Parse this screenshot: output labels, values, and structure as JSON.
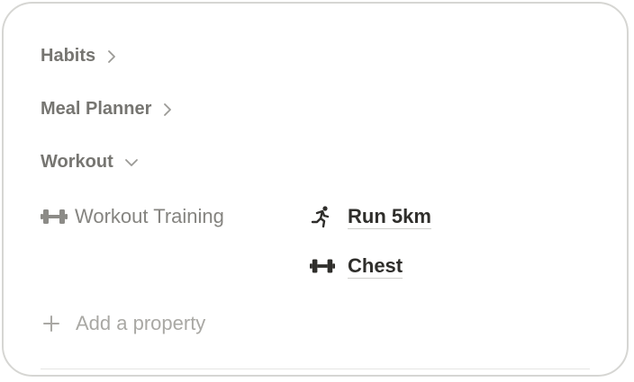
{
  "sections": [
    {
      "label": "Habits",
      "state": "collapsed"
    },
    {
      "label": "Meal Planner",
      "state": "collapsed"
    },
    {
      "label": "Workout",
      "state": "expanded"
    }
  ],
  "property": {
    "icon": "dumbbell-icon",
    "label": "Workout Training",
    "relations": [
      {
        "icon": "running-icon",
        "label": "Run 5km"
      },
      {
        "icon": "dumbbell-icon",
        "label": "Chest"
      }
    ]
  },
  "add_property": {
    "icon": "plus-icon",
    "label": "Add a property"
  },
  "colors": {
    "section_text": "#767571",
    "muted_text": "#858480",
    "relation_text": "#2f2e2b",
    "border": "#d6d6d3"
  }
}
